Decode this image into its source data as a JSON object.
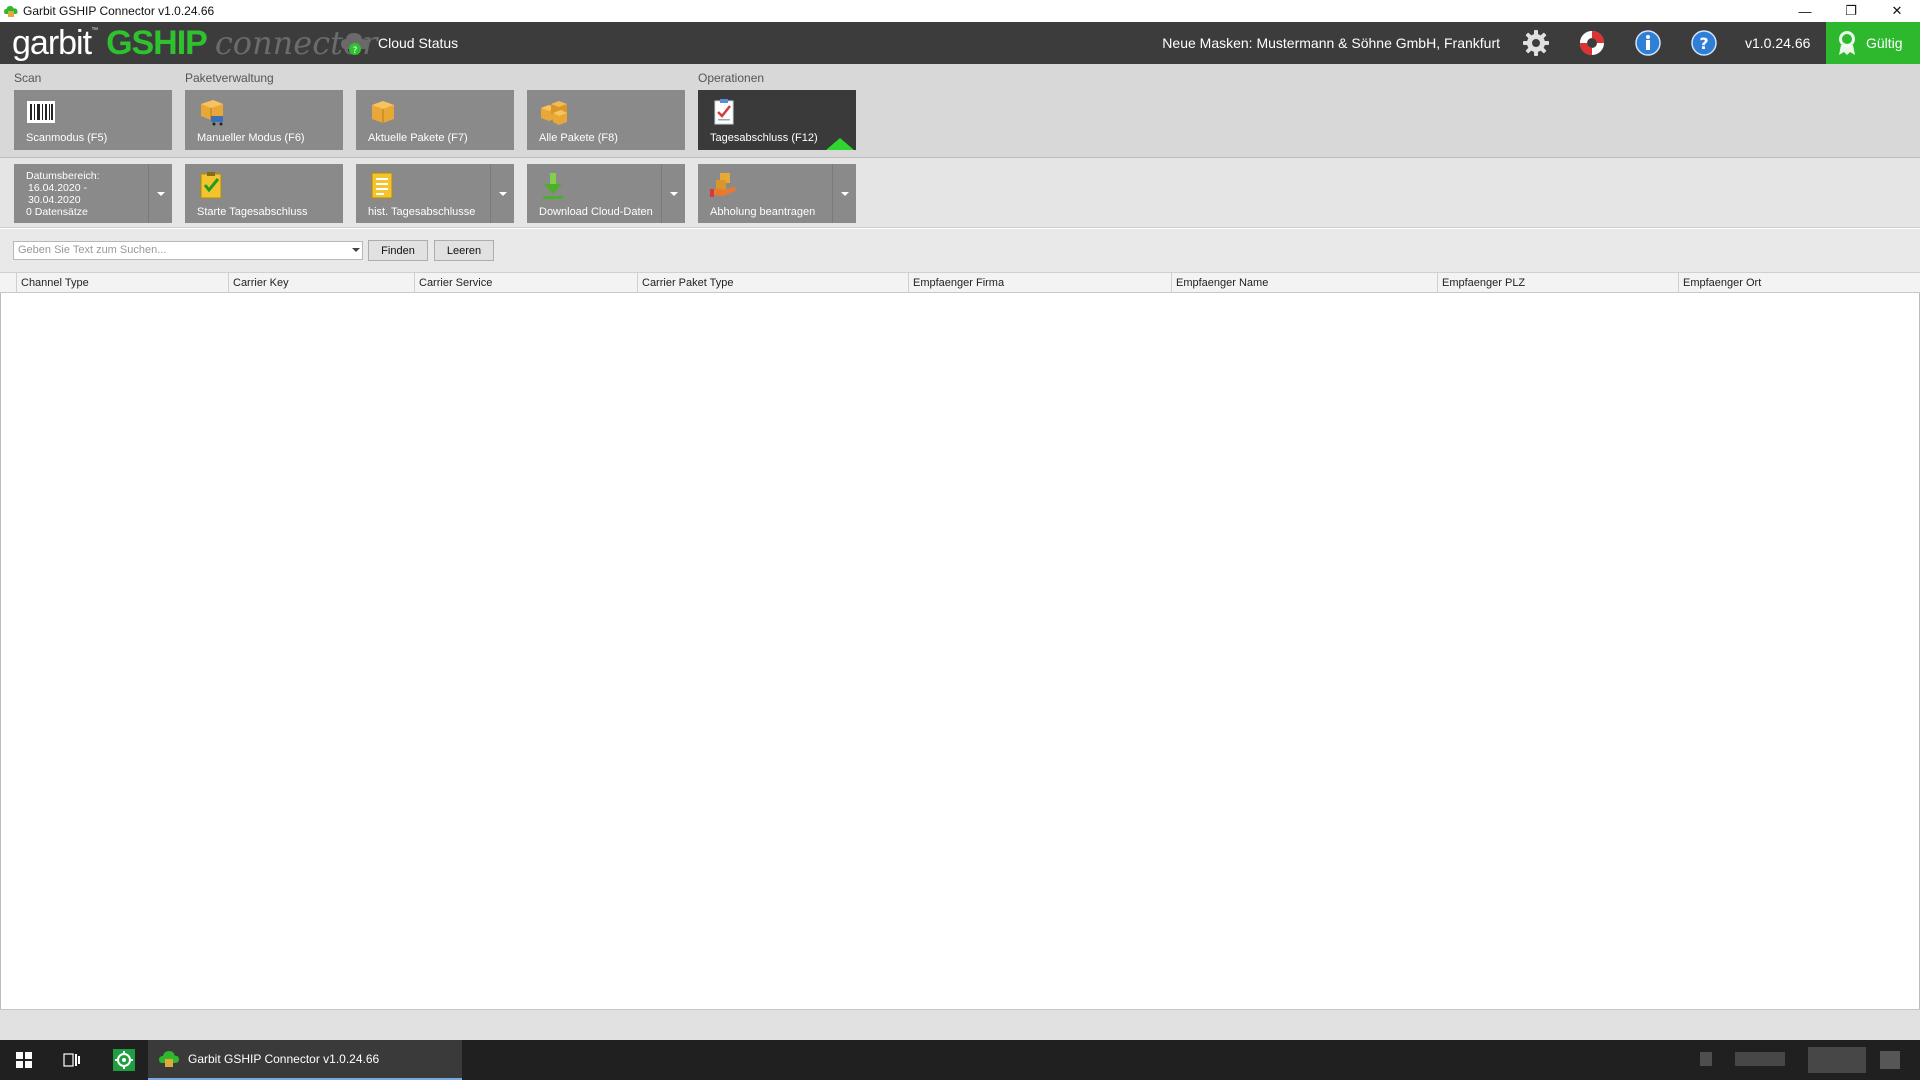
{
  "window": {
    "title": "Garbit GSHIP Connector v1.0.24.66",
    "controls": {
      "minimize": "—",
      "restore": "❐",
      "close": "✕"
    }
  },
  "header": {
    "logo_part1": "garbit",
    "logo_tm": "™",
    "logo_part2": "GSHIP",
    "logo_part3": "connector",
    "cloud_status": "Cloud Status",
    "company": "Neue Masken: Mustermann & Söhne GmbH, Frankfurt",
    "version": "v1.0.24.66",
    "license": "Gültig",
    "icons": [
      "gear-icon",
      "lifebuoy-icon",
      "info-icon",
      "help-icon"
    ],
    "accent": "#2fc22f"
  },
  "ribbon": {
    "groups": {
      "scan": "Scan",
      "paket": "Paketverwaltung",
      "ops": "Operationen"
    },
    "buttons": {
      "scan": "Scanmodus (F5)",
      "manual": "Manueller Modus (F6)",
      "current": "Aktuelle Pakete (F7)",
      "all": "Alle Pakete (F8)",
      "closing": "Tagesabschluss (F12)"
    }
  },
  "subribbon": {
    "date": {
      "label": "Datumsbereich:",
      "from": "16.04.2020 -",
      "to": "30.04.2020",
      "count": "0 Datensätze"
    },
    "buttons": {
      "start": "Starte Tagesabschluss",
      "hist": "hist. Tagesabschlusse",
      "download": "Download Cloud-Daten",
      "pickup": "Abholung beantragen"
    }
  },
  "search": {
    "placeholder": "Geben Sie Text zum Suchen...",
    "find": "Finden",
    "clear": "Leeren"
  },
  "grid": {
    "columns": [
      "Channel Type",
      "Carrier Key",
      "Carrier Service",
      "Carrier Paket Type",
      "Empfaenger Firma",
      "Empfaenger Name",
      "Empfaenger PLZ",
      "Empfaenger Ort"
    ],
    "rows": []
  },
  "taskbar": {
    "app_label": "Garbit GSHIP Connector v1.0.24.66"
  }
}
